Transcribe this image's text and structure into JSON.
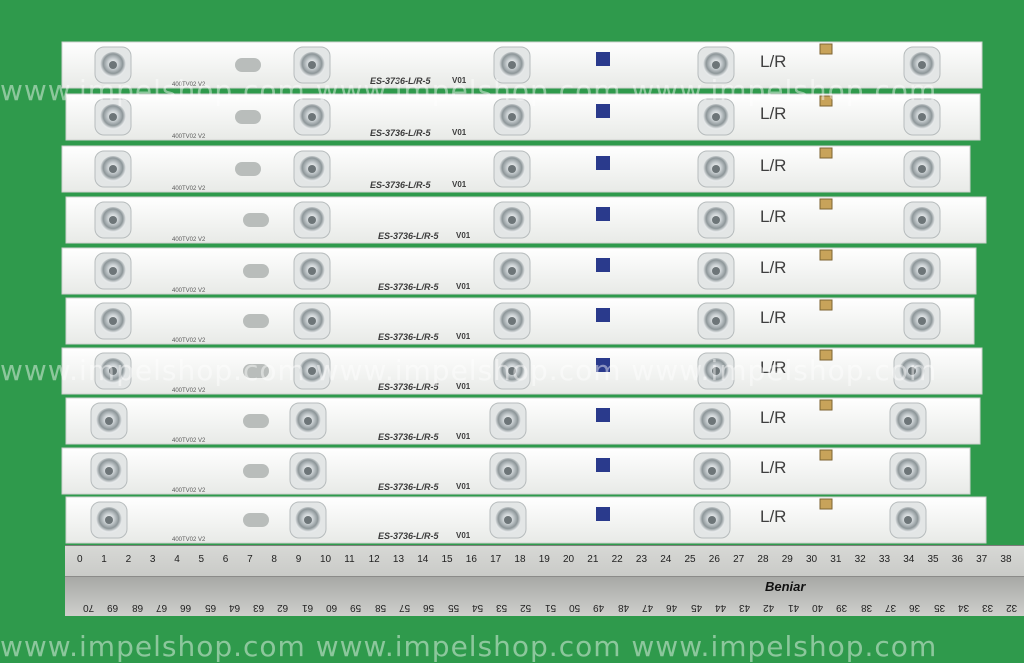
{
  "watermark": "www.impelshop.com  www.impelshop.com  www.impelshop.com",
  "strip": {
    "part": "ES-3736-L/R-5",
    "version": "V01",
    "side_mark": "L/R",
    "edge_text": "400TV02 V2"
  },
  "ruler": {
    "brand": "Beniar",
    "top_numbers": [
      "0",
      "1",
      "2",
      "3",
      "4",
      "5",
      "6",
      "7",
      "8",
      "9",
      "10",
      "11",
      "12",
      "13",
      "14",
      "15",
      "16",
      "17",
      "18",
      "19",
      "20",
      "21",
      "22",
      "23",
      "24",
      "25",
      "26",
      "27",
      "28",
      "29",
      "30",
      "31",
      "32",
      "33",
      "34",
      "35",
      "36",
      "37",
      "38"
    ],
    "bottom_numbers": [
      "70",
      "69",
      "68",
      "67",
      "66",
      "65",
      "64",
      "63",
      "62",
      "61",
      "60",
      "59",
      "58",
      "57",
      "56",
      "55",
      "54",
      "53",
      "52",
      "51",
      "50",
      "49",
      "48",
      "47",
      "46",
      "45",
      "44",
      "43",
      "42",
      "41",
      "40",
      "39",
      "38",
      "37",
      "36",
      "35",
      "34",
      "33",
      "32"
    ]
  },
  "colors": {
    "background": "#2f9a4c",
    "strip": "#f3f4f2",
    "ruler": "#cfcfcc"
  }
}
